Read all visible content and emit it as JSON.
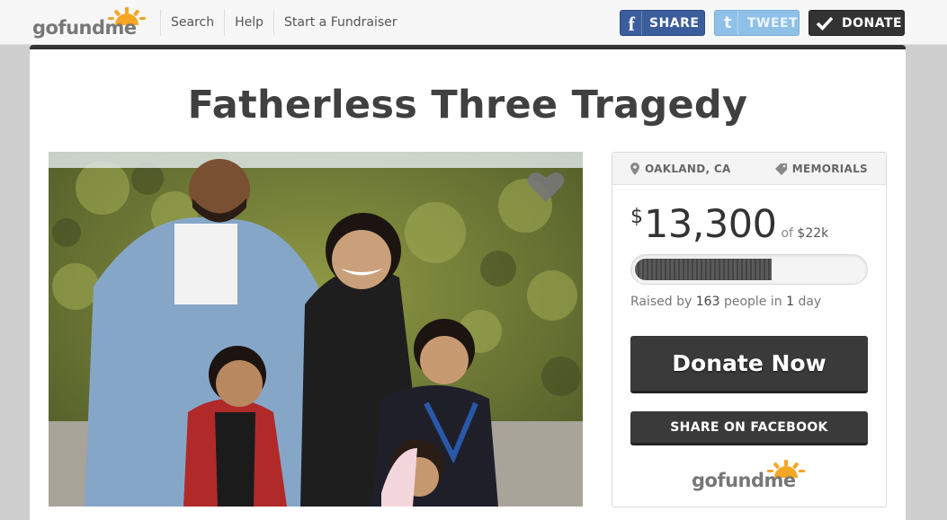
{
  "header": {
    "logo_text": "gofundme",
    "nav": [
      "Search",
      "Help",
      "Start a Fundraiser"
    ],
    "buttons": {
      "share": "SHARE",
      "tweet": "TWEET",
      "donate": "DONATE"
    },
    "facebook_glyph": "f",
    "twitter_glyph": "t"
  },
  "campaign": {
    "title": "Fatherless Three Tragedy",
    "location": "OAKLAND, CA",
    "category": "MEMORIALS",
    "currency": "$",
    "amount": "13,300",
    "of_label": "of",
    "goal": "$22k",
    "progress_fraction": 0.6,
    "raised_prefix": "Raised by",
    "donor_count": "163",
    "raised_middle": "people in",
    "days": "1",
    "raised_suffix": "day",
    "donate_button": "Donate Now",
    "share_button": "SHARE ON FACEBOOK",
    "footer_logo_text": "gofundme"
  },
  "colors": {
    "facebook": "#3b5d9c",
    "twitter": "#8ec0e8",
    "dark_button": "#333333",
    "logo_sun": "#f5a623"
  },
  "icons": [
    "facebook-icon",
    "twitter-icon",
    "checkmark-icon",
    "heart-icon",
    "location-pin-icon",
    "tag-icon"
  ]
}
